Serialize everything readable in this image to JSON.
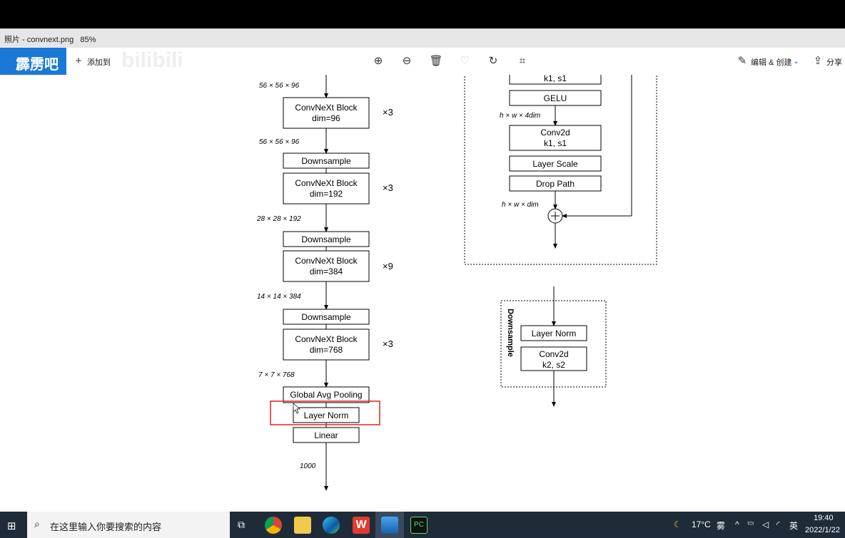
{
  "window": {
    "title": "照片 - convnext.png",
    "zoom": "85%"
  },
  "toolbar": {
    "badge": "霹雳吧",
    "add_to": "添加到",
    "watermark": "bilibili",
    "edit_create": "编辑 & 创建",
    "share": "分享",
    "icons": [
      "zoom-in-icon",
      "zoom-out-icon",
      "delete-icon",
      "favorite-icon",
      "rotate-icon",
      "crop-icon"
    ]
  },
  "diagram": {
    "left": {
      "dims": [
        "56 × 56 × 96",
        "56 × 56 × 96",
        "28 × 28 × 192",
        "14 × 14 × 384",
        "7 × 7 × 768",
        "1000"
      ],
      "stages": [
        {
          "title": "ConvNeXt Block",
          "dim": "dim=96",
          "repeat": "×3"
        },
        {
          "title": "ConvNeXt Block",
          "dim": "dim=192",
          "repeat": "×3"
        },
        {
          "title": "ConvNeXt Block",
          "dim": "dim=384",
          "repeat": "×9"
        },
        {
          "title": "ConvNeXt Block",
          "dim": "dim=768",
          "repeat": "×3"
        }
      ],
      "downsample": "Downsample",
      "pool": "Global Avg Pooling",
      "norm": "Layer Norm",
      "linear": "Linear"
    },
    "block": {
      "conv_top": "k1, s1",
      "gelu": "GELU",
      "label_4dim": "h × w × 4dim",
      "conv2_l1": "Conv2d",
      "conv2_l2": "k1, s1",
      "layer_scale": "Layer Scale",
      "drop_path": "Drop Path",
      "label_dim": "h × w × dim"
    },
    "ds": {
      "title": "Downsample",
      "norm": "Layer Norm",
      "conv_l1": "Conv2d",
      "conv_l2": "k2, s2"
    },
    "highlight_color": "#e02020"
  },
  "taskbar": {
    "search_placeholder": "在这里输入你要搜索的内容",
    "weather": "17°C",
    "weather_desc": "雾",
    "ime": "英",
    "time": "19:40",
    "date": "2022/1/22"
  }
}
